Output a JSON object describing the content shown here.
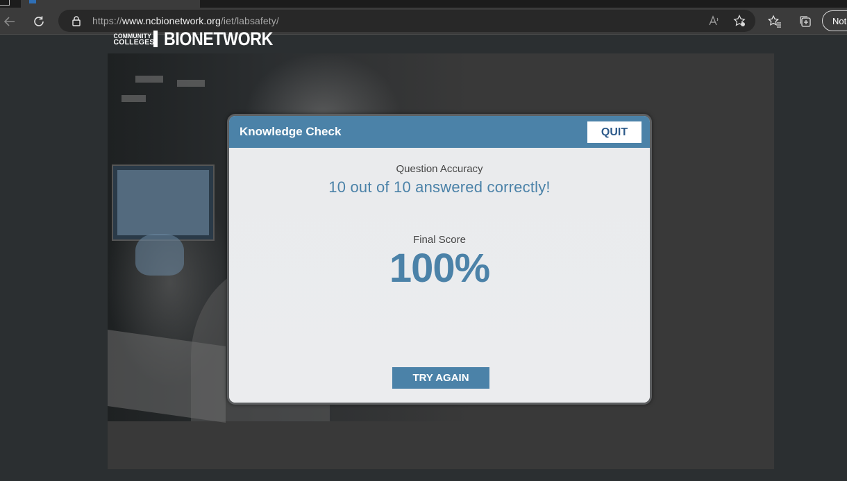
{
  "browser": {
    "url_prefix": "https://",
    "url_host": "www.ncbionetwork.org",
    "url_path": "/iet/labsafety/",
    "profile_button_label": "Not"
  },
  "site": {
    "logo_line1": "COMMUNITY",
    "logo_line2": "COLLEGES",
    "logo_name": "BIONETWORK"
  },
  "modal": {
    "title": "Knowledge Check",
    "quit_label": "QUIT",
    "accuracy_label": "Question Accuracy",
    "accuracy_value": "10 out of 10 answered correctly!",
    "score_label": "Final Score",
    "score_value": "100%",
    "try_again_label": "TRY AGAIN"
  },
  "colors": {
    "accent": "#4b82a8",
    "quit_text": "#2d5a8a",
    "modal_bg": "#ebecee",
    "page_bg": "#2b2f31"
  },
  "icons": {
    "back": "arrow-left-icon",
    "reload": "reload-icon",
    "lock": "lock-icon",
    "read_aloud": "read-aloud-icon",
    "add_favorite": "add-favorite-icon",
    "favorites": "favorites-icon",
    "collections": "collections-icon"
  }
}
